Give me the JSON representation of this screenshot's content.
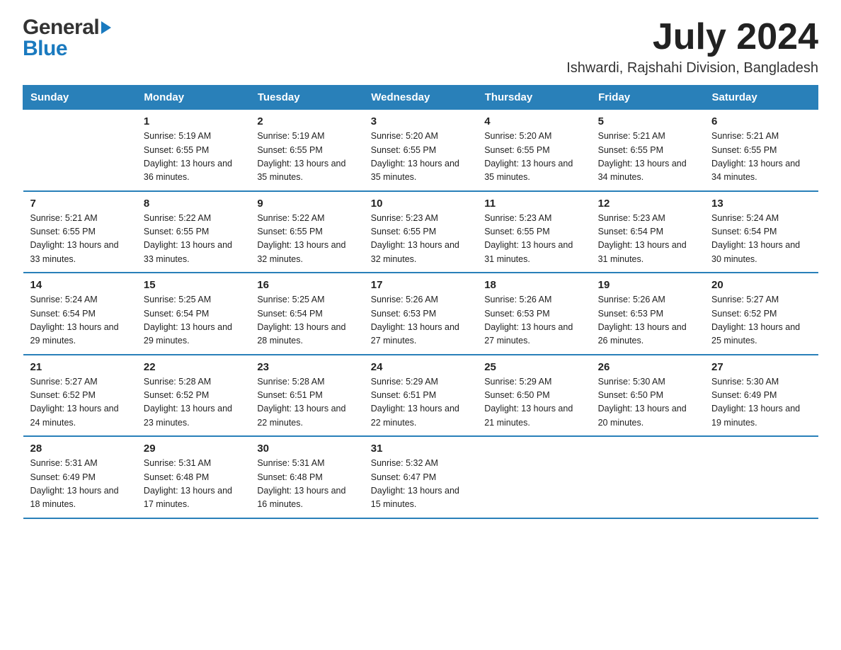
{
  "header": {
    "month_year": "July 2024",
    "location": "Ishwardi, Rajshahi Division, Bangladesh",
    "logo_general": "General",
    "logo_blue": "Blue"
  },
  "days_of_week": [
    "Sunday",
    "Monday",
    "Tuesday",
    "Wednesday",
    "Thursday",
    "Friday",
    "Saturday"
  ],
  "weeks": [
    [
      {
        "day": "",
        "sunrise": "",
        "sunset": "",
        "daylight": ""
      },
      {
        "day": "1",
        "sunrise": "Sunrise: 5:19 AM",
        "sunset": "Sunset: 6:55 PM",
        "daylight": "Daylight: 13 hours and 36 minutes."
      },
      {
        "day": "2",
        "sunrise": "Sunrise: 5:19 AM",
        "sunset": "Sunset: 6:55 PM",
        "daylight": "Daylight: 13 hours and 35 minutes."
      },
      {
        "day": "3",
        "sunrise": "Sunrise: 5:20 AM",
        "sunset": "Sunset: 6:55 PM",
        "daylight": "Daylight: 13 hours and 35 minutes."
      },
      {
        "day": "4",
        "sunrise": "Sunrise: 5:20 AM",
        "sunset": "Sunset: 6:55 PM",
        "daylight": "Daylight: 13 hours and 35 minutes."
      },
      {
        "day": "5",
        "sunrise": "Sunrise: 5:21 AM",
        "sunset": "Sunset: 6:55 PM",
        "daylight": "Daylight: 13 hours and 34 minutes."
      },
      {
        "day": "6",
        "sunrise": "Sunrise: 5:21 AM",
        "sunset": "Sunset: 6:55 PM",
        "daylight": "Daylight: 13 hours and 34 minutes."
      }
    ],
    [
      {
        "day": "7",
        "sunrise": "Sunrise: 5:21 AM",
        "sunset": "Sunset: 6:55 PM",
        "daylight": "Daylight: 13 hours and 33 minutes."
      },
      {
        "day": "8",
        "sunrise": "Sunrise: 5:22 AM",
        "sunset": "Sunset: 6:55 PM",
        "daylight": "Daylight: 13 hours and 33 minutes."
      },
      {
        "day": "9",
        "sunrise": "Sunrise: 5:22 AM",
        "sunset": "Sunset: 6:55 PM",
        "daylight": "Daylight: 13 hours and 32 minutes."
      },
      {
        "day": "10",
        "sunrise": "Sunrise: 5:23 AM",
        "sunset": "Sunset: 6:55 PM",
        "daylight": "Daylight: 13 hours and 32 minutes."
      },
      {
        "day": "11",
        "sunrise": "Sunrise: 5:23 AM",
        "sunset": "Sunset: 6:55 PM",
        "daylight": "Daylight: 13 hours and 31 minutes."
      },
      {
        "day": "12",
        "sunrise": "Sunrise: 5:23 AM",
        "sunset": "Sunset: 6:54 PM",
        "daylight": "Daylight: 13 hours and 31 minutes."
      },
      {
        "day": "13",
        "sunrise": "Sunrise: 5:24 AM",
        "sunset": "Sunset: 6:54 PM",
        "daylight": "Daylight: 13 hours and 30 minutes."
      }
    ],
    [
      {
        "day": "14",
        "sunrise": "Sunrise: 5:24 AM",
        "sunset": "Sunset: 6:54 PM",
        "daylight": "Daylight: 13 hours and 29 minutes."
      },
      {
        "day": "15",
        "sunrise": "Sunrise: 5:25 AM",
        "sunset": "Sunset: 6:54 PM",
        "daylight": "Daylight: 13 hours and 29 minutes."
      },
      {
        "day": "16",
        "sunrise": "Sunrise: 5:25 AM",
        "sunset": "Sunset: 6:54 PM",
        "daylight": "Daylight: 13 hours and 28 minutes."
      },
      {
        "day": "17",
        "sunrise": "Sunrise: 5:26 AM",
        "sunset": "Sunset: 6:53 PM",
        "daylight": "Daylight: 13 hours and 27 minutes."
      },
      {
        "day": "18",
        "sunrise": "Sunrise: 5:26 AM",
        "sunset": "Sunset: 6:53 PM",
        "daylight": "Daylight: 13 hours and 27 minutes."
      },
      {
        "day": "19",
        "sunrise": "Sunrise: 5:26 AM",
        "sunset": "Sunset: 6:53 PM",
        "daylight": "Daylight: 13 hours and 26 minutes."
      },
      {
        "day": "20",
        "sunrise": "Sunrise: 5:27 AM",
        "sunset": "Sunset: 6:52 PM",
        "daylight": "Daylight: 13 hours and 25 minutes."
      }
    ],
    [
      {
        "day": "21",
        "sunrise": "Sunrise: 5:27 AM",
        "sunset": "Sunset: 6:52 PM",
        "daylight": "Daylight: 13 hours and 24 minutes."
      },
      {
        "day": "22",
        "sunrise": "Sunrise: 5:28 AM",
        "sunset": "Sunset: 6:52 PM",
        "daylight": "Daylight: 13 hours and 23 minutes."
      },
      {
        "day": "23",
        "sunrise": "Sunrise: 5:28 AM",
        "sunset": "Sunset: 6:51 PM",
        "daylight": "Daylight: 13 hours and 22 minutes."
      },
      {
        "day": "24",
        "sunrise": "Sunrise: 5:29 AM",
        "sunset": "Sunset: 6:51 PM",
        "daylight": "Daylight: 13 hours and 22 minutes."
      },
      {
        "day": "25",
        "sunrise": "Sunrise: 5:29 AM",
        "sunset": "Sunset: 6:50 PM",
        "daylight": "Daylight: 13 hours and 21 minutes."
      },
      {
        "day": "26",
        "sunrise": "Sunrise: 5:30 AM",
        "sunset": "Sunset: 6:50 PM",
        "daylight": "Daylight: 13 hours and 20 minutes."
      },
      {
        "day": "27",
        "sunrise": "Sunrise: 5:30 AM",
        "sunset": "Sunset: 6:49 PM",
        "daylight": "Daylight: 13 hours and 19 minutes."
      }
    ],
    [
      {
        "day": "28",
        "sunrise": "Sunrise: 5:31 AM",
        "sunset": "Sunset: 6:49 PM",
        "daylight": "Daylight: 13 hours and 18 minutes."
      },
      {
        "day": "29",
        "sunrise": "Sunrise: 5:31 AM",
        "sunset": "Sunset: 6:48 PM",
        "daylight": "Daylight: 13 hours and 17 minutes."
      },
      {
        "day": "30",
        "sunrise": "Sunrise: 5:31 AM",
        "sunset": "Sunset: 6:48 PM",
        "daylight": "Daylight: 13 hours and 16 minutes."
      },
      {
        "day": "31",
        "sunrise": "Sunrise: 5:32 AM",
        "sunset": "Sunset: 6:47 PM",
        "daylight": "Daylight: 13 hours and 15 minutes."
      },
      {
        "day": "",
        "sunrise": "",
        "sunset": "",
        "daylight": ""
      },
      {
        "day": "",
        "sunrise": "",
        "sunset": "",
        "daylight": ""
      },
      {
        "day": "",
        "sunrise": "",
        "sunset": "",
        "daylight": ""
      }
    ]
  ]
}
